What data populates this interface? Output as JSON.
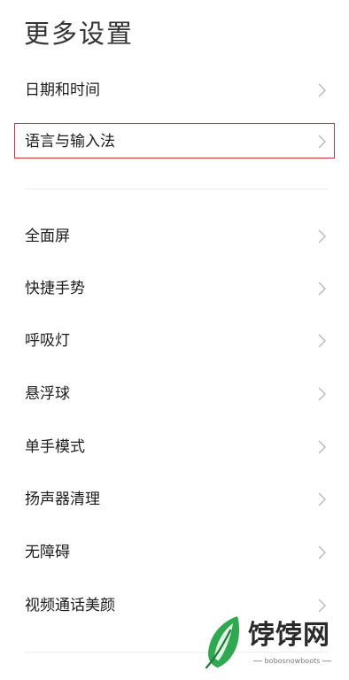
{
  "header": {
    "title": "更多设置"
  },
  "settings": {
    "group1": [
      {
        "label": "日期和时间"
      },
      {
        "label": "语言与输入法"
      }
    ],
    "group2": [
      {
        "label": "全面屏"
      },
      {
        "label": "快捷手势"
      },
      {
        "label": "呼吸灯"
      },
      {
        "label": "悬浮球"
      },
      {
        "label": "单手模式"
      },
      {
        "label": "扬声器清理"
      },
      {
        "label": "无障碍"
      },
      {
        "label": "视频通话美颜"
      }
    ]
  },
  "highlighted_item": "语言与输入法",
  "colors": {
    "highlight_border": "#d0333c",
    "chevron": "#b8b8b8",
    "logo_green": "#2fa84f"
  },
  "watermark": {
    "name": "饽饽网",
    "url": "bobosnowboots"
  }
}
